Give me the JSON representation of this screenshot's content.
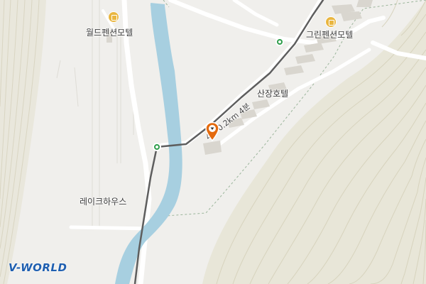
{
  "map": {
    "colors": {
      "land": "#f0efec",
      "hill": "#e8e6d9",
      "contour": "#d7d3be",
      "river": "#a7cfe0",
      "road": "#ffffff",
      "route": "#5a5a5a",
      "stop": "#2e9d4a",
      "poi": "#e9b640",
      "marker": "#e46a0d"
    },
    "labels": {
      "world_pension_motel": "월드펜션모텔",
      "green_pension_motel": "그린펜션모텔",
      "sanjang_hotel": "산장호텔",
      "lake_house": "레이크하우스",
      "route_info": "4분 0.2km 4분"
    },
    "icons": {
      "poi": "building-icon",
      "stop": "route-node-icon",
      "marker": "destination-pin-icon"
    },
    "logo": "V-WORLD"
  }
}
